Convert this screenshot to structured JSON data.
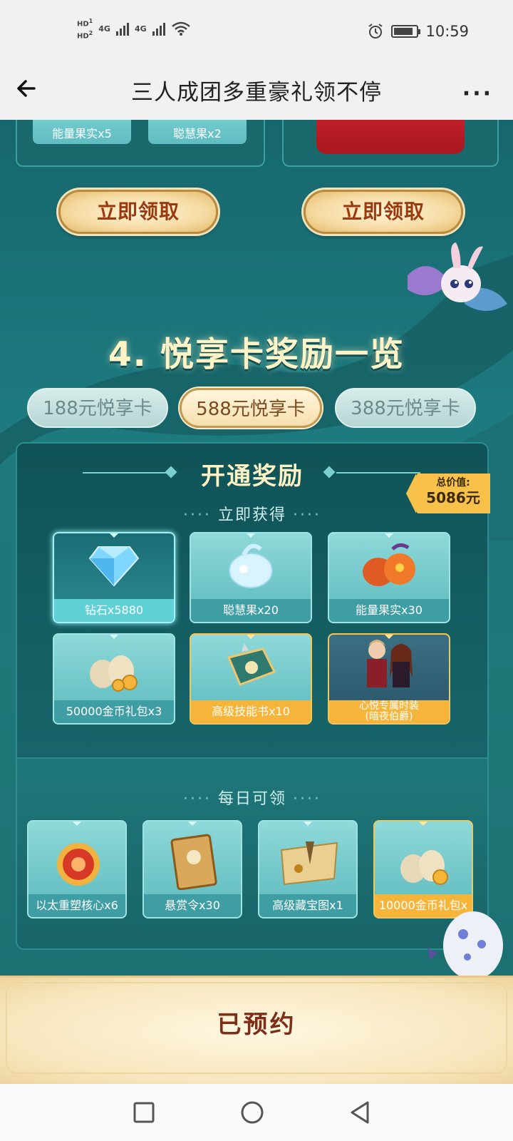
{
  "status_bar": {
    "hd1": "HD",
    "sim1": "1",
    "hd2": "HD",
    "sim2": "2",
    "net1": "4G",
    "net2": "4G",
    "time": "10:59"
  },
  "title_bar": {
    "title": "三人成团多重豪礼领不停",
    "more": "···"
  },
  "top_cards": {
    "items": [
      "能量果实x5",
      "聪慧果x2"
    ],
    "claim_left": "立即领取",
    "claim_right": "立即领取"
  },
  "section": {
    "title": "4. 悦享卡奖励一览"
  },
  "tabs": [
    {
      "label": "188元悦享卡",
      "active": false
    },
    {
      "label": "588元悦享卡",
      "active": true
    },
    {
      "label": "388元悦享卡",
      "active": false
    }
  ],
  "panel": {
    "title": "开通奖励",
    "instant_label": "立即获得",
    "daily_label": "每日可领",
    "price_tag_line1": "总价值:",
    "price_tag_line2": "5086元",
    "instant_items": [
      {
        "label": "钻石x5880",
        "icon": "diamond-icon"
      },
      {
        "label": "聪慧果x20",
        "icon": "wisdom-fruit-icon"
      },
      {
        "label": "能量果实x30",
        "icon": "energy-fruit-icon"
      },
      {
        "label": "50000金币礼包x3",
        "icon": "coin-bag-icon"
      },
      {
        "label": "高级技能书x10",
        "icon": "skill-book-icon"
      },
      {
        "label": "心悦专属时装",
        "label2": "(暗夜伯爵)",
        "icon": "costume-icon"
      }
    ],
    "daily_items": [
      {
        "label": "以太重塑核心x6",
        "icon": "ether-core-icon"
      },
      {
        "label": "悬赏令x30",
        "icon": "bounty-order-icon"
      },
      {
        "label": "高级藏宝图x1",
        "icon": "treasure-map-icon"
      },
      {
        "label": "10000金币礼包x",
        "icon": "coin-bag-icon"
      }
    ]
  },
  "reserve": {
    "label": "已预约"
  },
  "colors": {
    "teal_bg": "#1e6e72",
    "gold": "#f5b53a",
    "title_cream": "#fff3c8",
    "button_text": "#9a3a10"
  }
}
